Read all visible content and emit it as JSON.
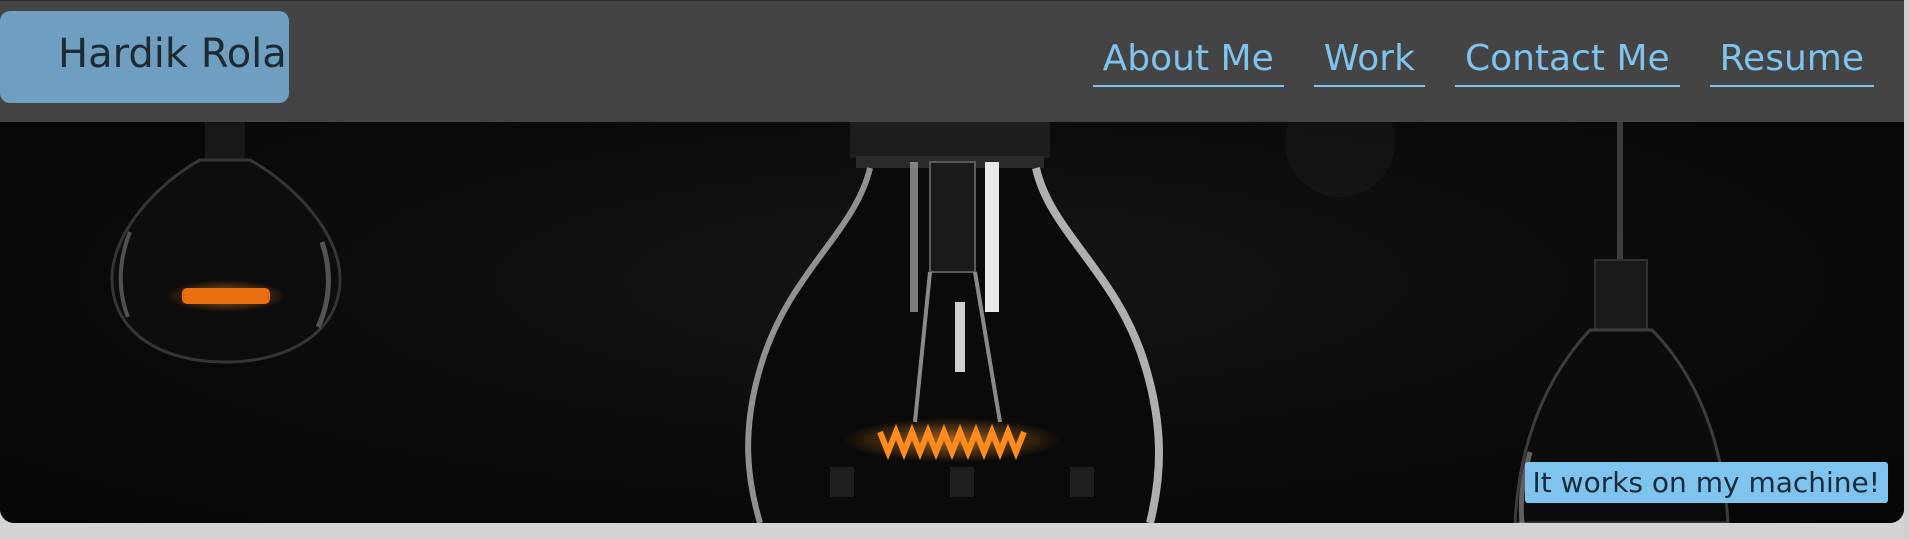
{
  "brand": {
    "name": "Hardik Rola"
  },
  "nav": {
    "items": [
      {
        "label": "About Me"
      },
      {
        "label": "Work"
      },
      {
        "label": "Contact Me"
      },
      {
        "label": "Resume"
      }
    ]
  },
  "hero": {
    "tagline": "It works on my machine!"
  },
  "colors": {
    "header_bg": "#444444",
    "brand_bg": "#6f9fc0",
    "link": "#7ec4ef",
    "filament": "#ff8a1e"
  }
}
